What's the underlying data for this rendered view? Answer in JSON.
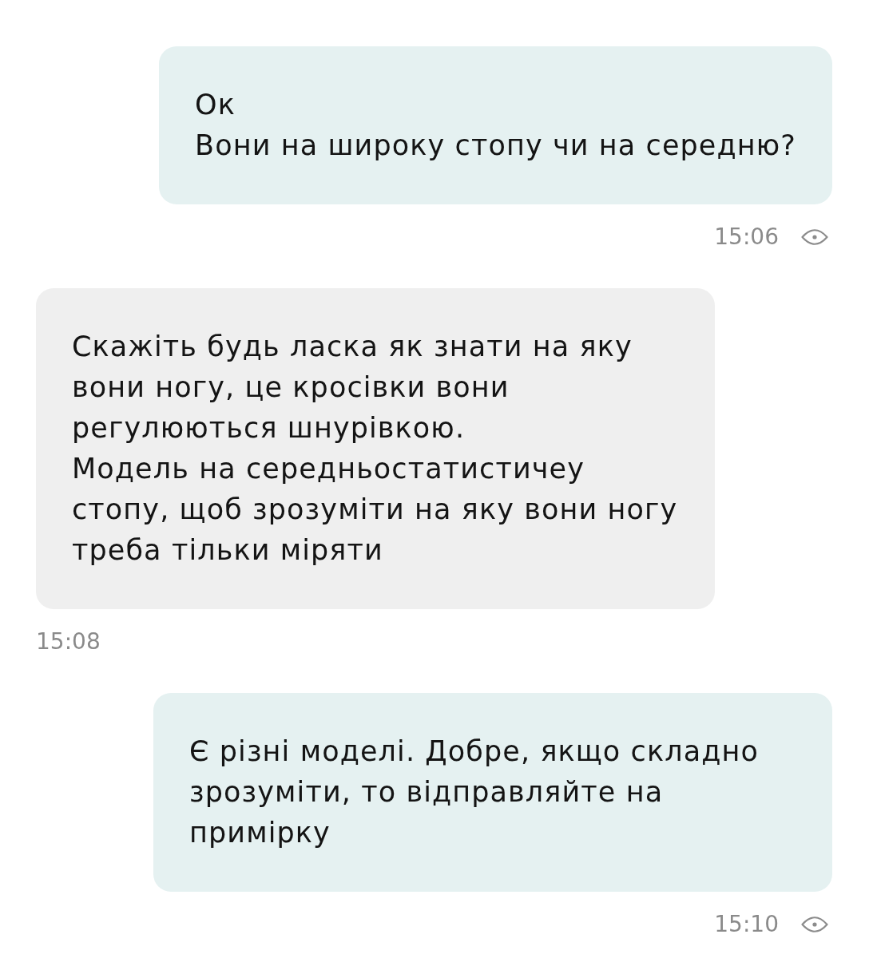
{
  "messages": [
    {
      "kind": "outgoing",
      "text": "Ок\nВони на широку стопу чи на середню?",
      "time": "15:06",
      "seen": true
    },
    {
      "kind": "incoming",
      "text": "Скажіть будь ласка як знати на яку вони ногу, це кросівки вони регулюються шнурівкою.\nМодель на середньостатистичеу стопу, щоб зрозуміти на яку вони ногу треба тільки міряти",
      "time": "15:08"
    },
    {
      "kind": "outgoing",
      "text": "Є різні моделі. Добре, якщо складно зрозуміти, то відправляйте на примірку",
      "time": "15:10",
      "seen": true
    }
  ]
}
